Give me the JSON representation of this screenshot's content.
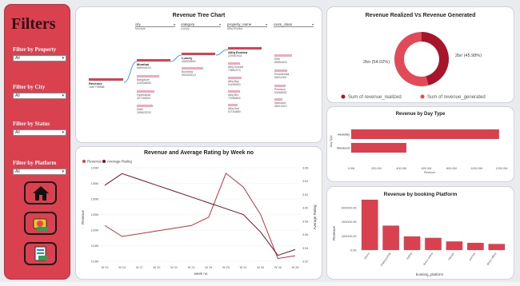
{
  "sidebar": {
    "title": "Filters",
    "filters": [
      {
        "label": "Filter by Property",
        "value": "All"
      },
      {
        "label": "Filter by City",
        "value": "All"
      },
      {
        "label": "Filter by Status",
        "value": "All"
      },
      {
        "label": "Filter by Platform",
        "value": "All"
      }
    ],
    "nav_icons": [
      "home-icon",
      "money-bag-icon",
      "receipt-icon"
    ],
    "bg_color": "#d9414f"
  },
  "tree": {
    "title": "Revenue Tree Chart",
    "columns": [
      {
        "label": "city",
        "sub": "Mumbai"
      },
      {
        "label": "category",
        "sub": "Luxury"
      },
      {
        "label": "property_name",
        "sub": "Atliq Exotica"
      },
      {
        "label": "room_class",
        "sub": ""
      }
    ],
    "root": {
      "label": "Revenue",
      "value": "1687799888"
    },
    "cities": [
      {
        "label": "Mumbai",
        "value": "669949103"
      },
      {
        "label": "Bangalore",
        "value": "415006838"
      },
      {
        "label": "Hyderabad",
        "value": "327168257"
      },
      {
        "label": "Delhi",
        "value": "295823233"
      }
    ],
    "categories": [
      {
        "label": "Luxury",
        "value": "406539890"
      },
      {
        "label": "Business",
        "value": "263409213"
      }
    ],
    "properties": [
      {
        "label": "Atliq Exotica",
        "value": "229957602"
      },
      {
        "label": "Atliq Grands",
        "value": "73852273"
      },
      {
        "label": "Atliq Bay",
        "value": "91695000"
      },
      {
        "label": "Atliq Blu",
        "value": "73356892"
      },
      {
        "label": "Atliq Sea",
        "value": "57154889"
      }
    ],
    "room_classes": [
      {
        "label": "Elite",
        "value": "86854402"
      },
      {
        "label": "Presidential",
        "value": "58011900"
      },
      {
        "label": "Premium",
        "value": "53958392"
      },
      {
        "label": "Standard",
        "value": "38213322"
      }
    ]
  },
  "donut": {
    "title": "Revenue Realized Vs Revenue Generated",
    "left_label": "2bn (54.02%)",
    "right_label": "2bn (45.98%)",
    "legend": [
      "Sum of revenue_realized",
      "Sum of revenue_generated"
    ],
    "colors": [
      "#a8142a",
      "#e24a57"
    ]
  },
  "week": {
    "title": "Revenue and Average Rating by Week no",
    "legend": [
      "Revenue",
      "Average Rating"
    ],
    "xlabel": "week no",
    "ylabel_left": "Revenue",
    "ylabel_right": "Average Rating",
    "left_ticks": [
      "140M",
      "135M",
      "130M",
      "125M",
      "120M",
      "115M",
      "110M"
    ],
    "right_ticks": [
      "3.66",
      "3.64",
      "3.62",
      "3.60",
      "3.58",
      "3.56",
      "3.54",
      "3.52"
    ],
    "x_ticks": [
      "W 23",
      "W 24",
      "W 27",
      "W 20",
      "W 21",
      "W 22",
      "W 19",
      "W 25",
      "W 31",
      "W 30",
      "W 26",
      "W 28"
    ]
  },
  "daytype": {
    "title": "Revenue by Day Type",
    "ylabel": "Day Type",
    "xlabel": "Revenue",
    "categories": [
      "weekday",
      "Weekend"
    ],
    "x_ticks": [
      "0.0M",
      "200.0M",
      "400.0M",
      "600.0M",
      "800.0M",
      "1000.0M",
      "1200.0M"
    ]
  },
  "platform": {
    "title": "Revenue by booking Platform",
    "xlabel": "booking_platform",
    "ylabel": "Revenue",
    "y_ticks": [
      "600000.0K",
      "400000.0K",
      "200000.0K",
      "0.0K"
    ],
    "x_ticks": [
      "others",
      "makeyourtrip",
      "logtrip",
      "direct online",
      "tripster",
      "journey",
      "direct offline"
    ]
  },
  "chart_data": [
    {
      "type": "line",
      "title": "Revenue and Average Rating by Week no",
      "x": [
        "W 23",
        "W 24",
        "W 27",
        "W 20",
        "W 21",
        "W 22",
        "W 19",
        "W 25",
        "W 31",
        "W 30",
        "W 26",
        "W 28"
      ],
      "series": [
        {
          "name": "Revenue",
          "values": [
            121,
            117,
            118,
            119,
            120,
            121,
            124,
            140,
            135,
            125,
            109,
            110
          ]
        },
        {
          "name": "Average Rating",
          "values": [
            3.64,
            3.66,
            3.65,
            3.64,
            3.63,
            3.62,
            3.61,
            3.6,
            3.59,
            3.56,
            3.52,
            3.53
          ]
        }
      ],
      "ylim": [
        108,
        142
      ],
      "ylim_right": [
        3.51,
        3.67
      ]
    },
    {
      "type": "bar",
      "title": "Revenue by Day Type",
      "categories": [
        "weekday",
        "Weekend"
      ],
      "values": [
        1180,
        440
      ],
      "xlim": [
        0,
        1200
      ]
    },
    {
      "type": "bar",
      "title": "Revenue by booking Platform",
      "categories": [
        "others",
        "makeyourtrip",
        "logtrip",
        "direct online",
        "tripster",
        "journey",
        "direct offline"
      ],
      "values": [
        700000,
        340000,
        190000,
        170000,
        120000,
        100000,
        85000
      ],
      "ylim": [
        0,
        700000
      ]
    },
    {
      "type": "pie",
      "title": "Revenue Realized Vs Revenue Generated",
      "categories": [
        "Sum of revenue_realized",
        "Sum of revenue_generated"
      ],
      "values": [
        45.98,
        54.02
      ]
    }
  ]
}
